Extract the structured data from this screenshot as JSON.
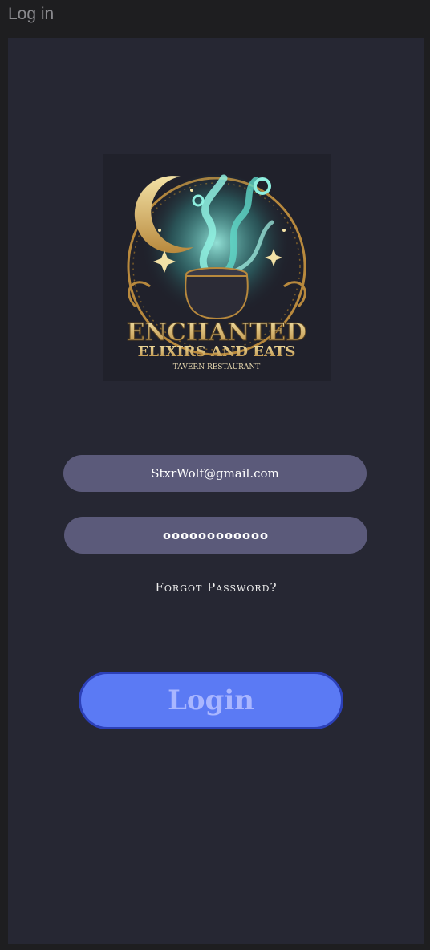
{
  "window": {
    "title": "Log in"
  },
  "logo": {
    "line1": "ENCHANTED",
    "line2": "ELIXIRS AND EATS",
    "line3": "TAVERN RESTAURANT"
  },
  "form": {
    "email_value": "StxrWolf@gmail.com",
    "password_value": "oooooooooooo",
    "forgot_label": "Forgot Password?",
    "login_label": "Login"
  },
  "colors": {
    "panel": "#262733",
    "field": "#5b5a7a",
    "button": "#5b7af4",
    "button_border": "#2c40b8",
    "button_text": "#a9b6ff"
  }
}
